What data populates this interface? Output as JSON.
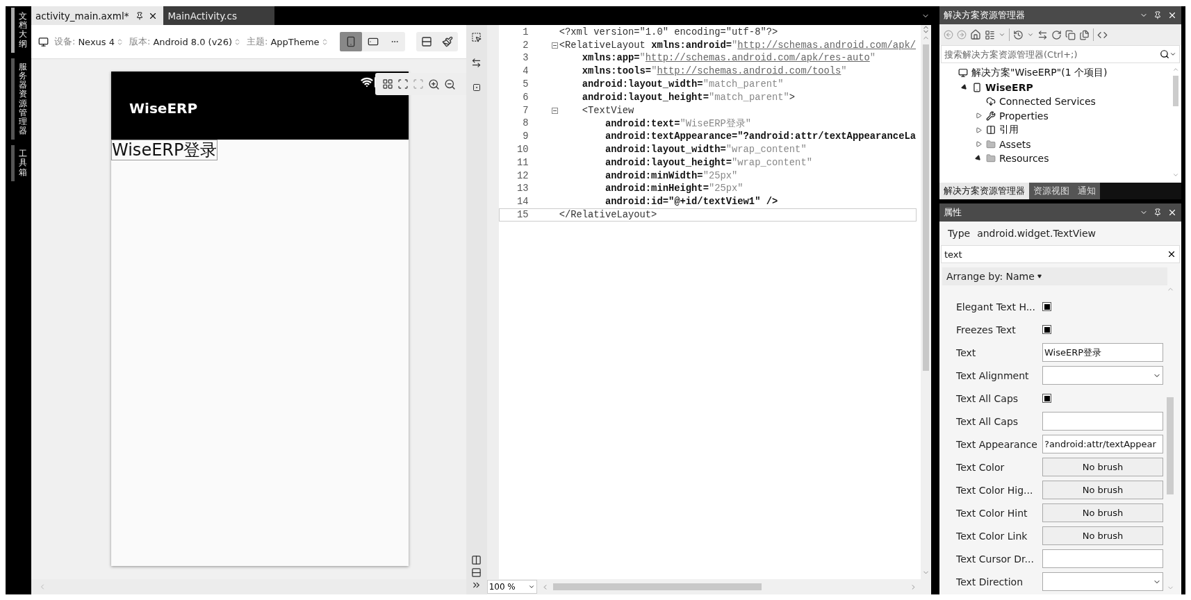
{
  "side_tabs": [
    {
      "label": "文档大纲",
      "selected": true
    },
    {
      "label": "服务器资源管理器",
      "selected": false
    },
    {
      "label": "工具箱",
      "selected": false
    }
  ],
  "doc_tabs": [
    {
      "label": "activity_main.axml*",
      "selected": true
    },
    {
      "label": "MainActivity.cs",
      "selected": false
    }
  ],
  "designer": {
    "toolbar": [
      {
        "label": "设备:",
        "value": "Nexus 4"
      },
      {
        "label": "版本:",
        "value": "Android 8.0 (v26)"
      },
      {
        "label": "主题:",
        "value": "AppTheme"
      }
    ],
    "orientation": [
      {
        "kind": "portrait",
        "selected": true
      },
      {
        "kind": "landscape",
        "selected": false
      }
    ],
    "phone": {
      "app_title": "WiseERP",
      "text_view": "WiseERP登录"
    }
  },
  "editor": {
    "lines": [
      {
        "number": "1",
        "fold": false,
        "tokens": [
          {
            "kind": "tag",
            "text": "<?xml version=\"1.0\" encoding=\"utf-8\"?>"
          }
        ]
      },
      {
        "number": "2",
        "fold": true,
        "tokens": [
          {
            "kind": "tag",
            "text": "<RelativeLayout "
          },
          {
            "kind": "attr",
            "text": "xmlns:android="
          },
          {
            "kind": "value",
            "text": "\""
          },
          {
            "kind": "link",
            "text": "http://schemas.android.com/apk/"
          }
        ]
      },
      {
        "number": "3",
        "fold": false,
        "tokens": [
          {
            "kind": "attr",
            "text": "    xmlns:app="
          },
          {
            "kind": "value",
            "text": "\""
          },
          {
            "kind": "link",
            "text": "http://schemas.android.com/apk/res-auto"
          },
          {
            "kind": "value",
            "text": "\""
          }
        ]
      },
      {
        "number": "4",
        "fold": false,
        "tokens": [
          {
            "kind": "attr",
            "text": "    xmlns:tools="
          },
          {
            "kind": "value",
            "text": "\""
          },
          {
            "kind": "link",
            "text": "http://schemas.android.com/tools"
          },
          {
            "kind": "value",
            "text": "\""
          }
        ]
      },
      {
        "number": "5",
        "fold": false,
        "tokens": [
          {
            "kind": "attr",
            "text": "    android:layout_width="
          },
          {
            "kind": "value",
            "text": "\"match_parent\""
          }
        ]
      },
      {
        "number": "6",
        "fold": false,
        "tokens": [
          {
            "kind": "attr",
            "text": "    android:layout_height="
          },
          {
            "kind": "value",
            "text": "\"match_parent\""
          },
          {
            "kind": "tag",
            "text": ">"
          }
        ]
      },
      {
        "number": "7",
        "fold": true,
        "tokens": [
          {
            "kind": "tag",
            "text": "    <TextView"
          }
        ]
      },
      {
        "number": "8",
        "fold": false,
        "tokens": [
          {
            "kind": "attr",
            "text": "        android:text="
          },
          {
            "kind": "value",
            "text": "\"WiseERP登录\""
          }
        ]
      },
      {
        "number": "9",
        "fold": false,
        "tokens": [
          {
            "kind": "attr",
            "text": "        android:textAppearance=\"?android:attr/textAppearanceLa"
          }
        ]
      },
      {
        "number": "10",
        "fold": false,
        "tokens": [
          {
            "kind": "attr",
            "text": "        android:layout_width="
          },
          {
            "kind": "value",
            "text": "\"wrap_content\""
          }
        ]
      },
      {
        "number": "11",
        "fold": false,
        "tokens": [
          {
            "kind": "attr",
            "text": "        android:layout_height="
          },
          {
            "kind": "value",
            "text": "\"wrap_content\""
          }
        ]
      },
      {
        "number": "12",
        "fold": false,
        "tokens": [
          {
            "kind": "attr",
            "text": "        android:minWidth="
          },
          {
            "kind": "value",
            "text": "\"25px\""
          }
        ]
      },
      {
        "number": "13",
        "fold": false,
        "tokens": [
          {
            "kind": "attr",
            "text": "        android:minHeight="
          },
          {
            "kind": "value",
            "text": "\"25px\""
          }
        ]
      },
      {
        "number": "14",
        "fold": false,
        "tokens": [
          {
            "kind": "attr",
            "text": "        android:id=\"@+id/textView1\" />"
          }
        ]
      },
      {
        "number": "15",
        "fold": false,
        "tokens": [
          {
            "kind": "tag",
            "text": "</RelativeLayout>"
          }
        ]
      }
    ],
    "zoom": "100 %"
  },
  "solution_explorer": {
    "title": "解决方案资源管理器",
    "search": {
      "placeholder": "搜索解决方案资源管理器(Ctrl+;)"
    },
    "tree": [
      {
        "label": "解决方案\"WiseERP\"(1 个项目)",
        "kind": "solution",
        "children": [
          {
            "label": "WiseERP",
            "kind": "project",
            "expanded": true,
            "children": [
              {
                "label": "Connected Services",
                "kind": "service"
              },
              {
                "label": "Properties",
                "kind": "properties",
                "expanded": false
              },
              {
                "label": "引用",
                "kind": "references",
                "expanded": false
              },
              {
                "label": "Assets",
                "kind": "folder",
                "expanded": false
              },
              {
                "label": "Resources",
                "kind": "folder",
                "expanded": true
              }
            ]
          }
        ]
      }
    ],
    "tabs": [
      {
        "label": "解决方案资源管理器",
        "selected": true
      },
      {
        "label": "资源视图",
        "selected": false
      },
      {
        "label": "通知",
        "selected": false
      }
    ]
  },
  "properties": {
    "title": "属性",
    "type_label": "Type",
    "type_value": "android.widget.TextView",
    "search": {
      "value": "text"
    },
    "arrange": "Arrange by: Name",
    "rows": [
      {
        "label": "Elegant Text H...",
        "kind": "checkbox",
        "checked": true
      },
      {
        "label": "Freezes Text",
        "kind": "checkbox",
        "checked": true
      },
      {
        "label": "Text",
        "kind": "text",
        "value": "WiseERP登录"
      },
      {
        "label": "Text Alignment",
        "kind": "select"
      },
      {
        "label": "Text All Caps",
        "kind": "checkbox",
        "checked": true
      },
      {
        "label": "Text All Caps",
        "kind": "text"
      },
      {
        "label": "Text Appearance",
        "kind": "text",
        "value": "?android:attr/textAppear"
      },
      {
        "label": "Text Color",
        "kind": "brush",
        "value": "No brush"
      },
      {
        "label": "Text Color Hig...",
        "kind": "brush",
        "value": "No brush"
      },
      {
        "label": "Text Color Hint",
        "kind": "brush",
        "value": "No brush"
      },
      {
        "label": "Text Color Link",
        "kind": "brush",
        "value": "No brush"
      },
      {
        "label": "Text Cursor Dr...",
        "kind": "text"
      },
      {
        "label": "Text Direction",
        "kind": "select"
      }
    ]
  }
}
